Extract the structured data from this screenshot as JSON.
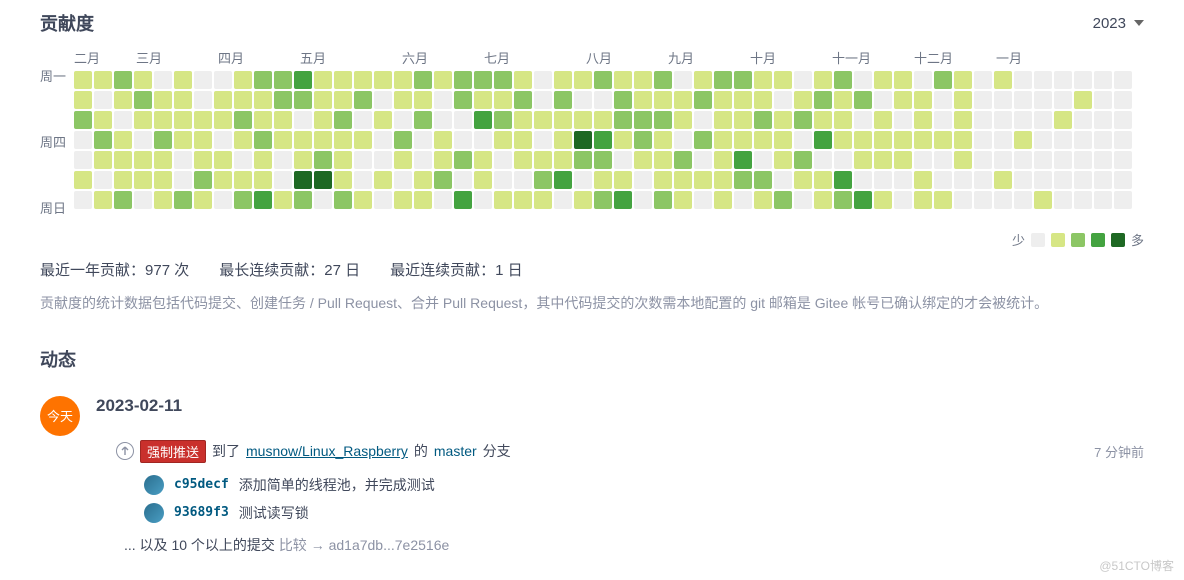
{
  "header": {
    "title": "贡献度",
    "year": "2023"
  },
  "months": [
    "二月",
    "三月",
    "四月",
    "五月",
    "六月",
    "七月",
    "八月",
    "九月",
    "十月",
    "十一月",
    "十二月",
    "一月"
  ],
  "days": [
    "周一",
    "",
    "",
    "周四",
    "",
    "",
    "周日"
  ],
  "legend": {
    "less": "少",
    "more": "多"
  },
  "stats": {
    "year_count_label": "最近一年贡献：",
    "year_count_value": "977 次",
    "longest_label": "最长连续贡献：",
    "longest_value": "27 日",
    "recent_label": "最近连续贡献：",
    "recent_value": "1 日"
  },
  "desc": "贡献度的统计数据包括代码提交、创建任务 / Pull Request、合并 Pull Request，其中代码提交的次数需本地配置的 git 邮箱是 Gitee 帐号已确认绑定的才会被统计。",
  "activity": {
    "title": "动态",
    "today": "今天",
    "date": "2023-02-11",
    "push": {
      "force_badge": "强制推送",
      "text1": "到了",
      "repo": "musnow/Linux_Raspberry",
      "text2": "的",
      "branch": "master",
      "text3": "分支",
      "time": "7 分钟前"
    },
    "commits": [
      {
        "hash": "c95decf",
        "msg": "添加简单的线程池，并完成测试"
      },
      {
        "hash": "93689f3",
        "msg": "测试读写锁"
      }
    ],
    "more": {
      "prefix": "... 以及 10 个以上的提交",
      "compare_label": "比较",
      "arrow": "→",
      "range": "ad1a7db...7e2516e"
    }
  },
  "watermark": "@51CTO博客",
  "contribution_grid": [
    [
      1,
      1,
      2,
      1,
      0,
      1,
      0,
      0,
      1,
      2,
      2,
      3,
      1,
      1,
      1,
      1,
      1,
      2,
      1,
      2,
      2,
      2,
      1,
      0,
      1,
      1,
      2,
      1,
      1,
      2,
      0,
      1,
      2,
      2,
      1,
      1,
      0,
      1,
      2,
      0,
      1,
      1,
      0,
      2,
      1,
      0,
      1,
      0,
      0,
      0,
      0,
      0,
      0
    ],
    [
      1,
      0,
      1,
      2,
      1,
      1,
      0,
      1,
      1,
      1,
      2,
      2,
      1,
      1,
      2,
      0,
      1,
      1,
      0,
      2,
      1,
      1,
      2,
      0,
      2,
      0,
      0,
      2,
      1,
      1,
      1,
      2,
      1,
      1,
      1,
      0,
      1,
      2,
      1,
      2,
      0,
      1,
      1,
      0,
      1,
      0,
      0,
      0,
      0,
      0,
      1,
      0,
      0
    ],
    [
      2,
      1,
      0,
      1,
      1,
      1,
      1,
      1,
      2,
      1,
      1,
      0,
      1,
      2,
      0,
      1,
      0,
      2,
      0,
      0,
      3,
      2,
      1,
      1,
      1,
      1,
      1,
      2,
      2,
      2,
      1,
      0,
      1,
      1,
      2,
      1,
      2,
      1,
      1,
      0,
      1,
      0,
      1,
      0,
      1,
      0,
      0,
      0,
      0,
      1,
      0,
      0,
      0
    ],
    [
      0,
      2,
      1,
      0,
      2,
      1,
      1,
      0,
      1,
      2,
      1,
      1,
      1,
      1,
      1,
      0,
      2,
      0,
      1,
      0,
      0,
      1,
      1,
      0,
      1,
      4,
      3,
      1,
      2,
      1,
      0,
      2,
      1,
      1,
      1,
      1,
      0,
      3,
      1,
      1,
      1,
      1,
      1,
      1,
      1,
      0,
      0,
      1,
      0,
      0,
      0,
      0,
      0
    ],
    [
      0,
      1,
      1,
      1,
      1,
      0,
      1,
      1,
      0,
      1,
      0,
      1,
      2,
      1,
      0,
      0,
      1,
      0,
      1,
      2,
      1,
      0,
      1,
      1,
      1,
      2,
      2,
      0,
      1,
      1,
      2,
      0,
      1,
      3,
      0,
      1,
      2,
      0,
      0,
      1,
      1,
      1,
      0,
      0,
      1,
      0,
      0,
      0,
      0,
      0,
      0,
      0,
      0
    ],
    [
      1,
      0,
      1,
      1,
      1,
      0,
      2,
      1,
      1,
      1,
      0,
      4,
      4,
      1,
      0,
      1,
      0,
      1,
      2,
      0,
      1,
      0,
      0,
      2,
      3,
      0,
      1,
      1,
      0,
      1,
      1,
      1,
      1,
      2,
      2,
      0,
      1,
      1,
      3,
      0,
      0,
      0,
      1,
      0,
      0,
      0,
      1,
      0,
      0,
      0,
      0,
      0,
      0
    ],
    [
      0,
      1,
      2,
      0,
      1,
      2,
      1,
      0,
      2,
      3,
      1,
      2,
      0,
      2,
      1,
      0,
      1,
      1,
      0,
      3,
      0,
      1,
      1,
      1,
      0,
      1,
      2,
      3,
      0,
      2,
      1,
      0,
      1,
      0,
      1,
      2,
      0,
      1,
      2,
      3,
      1,
      0,
      1,
      1,
      0,
      0,
      0,
      0,
      1,
      0,
      0,
      0,
      0
    ]
  ]
}
